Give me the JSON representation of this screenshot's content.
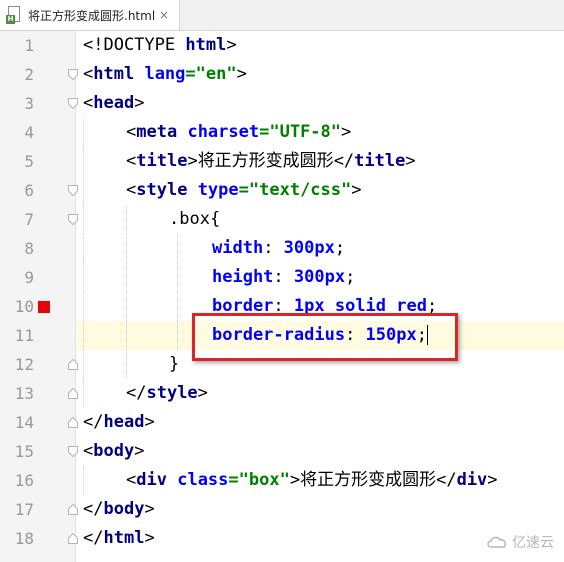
{
  "tab": {
    "title": "将正方形变成圆形.html",
    "icon": "html-file-icon",
    "close": "×"
  },
  "editor": {
    "current_line": 11,
    "breakpoint_line": 10,
    "colors": {
      "tag": "#000080",
      "attr": "#0000ff",
      "string": "#008000",
      "breakpoint": "#e8000b",
      "highlight_box": "#d62728",
      "current_line_bg": "#fffbe0"
    },
    "lines": [
      {
        "n": "1",
        "parts": [
          "<!DOCTYPE ",
          "html",
          ">"
        ]
      },
      {
        "n": "2",
        "parts": [
          "<",
          "html",
          " ",
          "lang",
          "=",
          "\"en\"",
          ">"
        ]
      },
      {
        "n": "3",
        "parts": [
          "<",
          "head",
          ">"
        ]
      },
      {
        "n": "4",
        "parts": [
          "<",
          "meta",
          " ",
          "charset",
          "=",
          "\"UTF-8\"",
          ">"
        ]
      },
      {
        "n": "5",
        "parts": [
          "<",
          "title",
          ">",
          "将正方形变成圆形",
          "</",
          "title",
          ">"
        ]
      },
      {
        "n": "6",
        "parts": [
          "<",
          "style",
          " ",
          "type",
          "=",
          "\"text/css\"",
          ">"
        ]
      },
      {
        "n": "7",
        "parts": [
          ".box{"
        ]
      },
      {
        "n": "8",
        "parts": [
          "width",
          ": ",
          "300px",
          ";"
        ]
      },
      {
        "n": "9",
        "parts": [
          "height",
          ": ",
          "300px",
          ";"
        ]
      },
      {
        "n": "10",
        "parts": [
          "border",
          ": ",
          "1px solid red",
          ";"
        ]
      },
      {
        "n": "11",
        "parts": [
          "border-radius",
          ": ",
          "150px",
          ";"
        ]
      },
      {
        "n": "12",
        "parts": [
          "}"
        ]
      },
      {
        "n": "13",
        "parts": [
          "</",
          "style",
          ">"
        ]
      },
      {
        "n": "14",
        "parts": [
          "</",
          "head",
          ">"
        ]
      },
      {
        "n": "15",
        "parts": [
          "<",
          "body",
          ">"
        ]
      },
      {
        "n": "16",
        "parts": [
          "<",
          "div",
          " ",
          "class",
          "=",
          "\"box\"",
          ">",
          "将正方形变成圆形",
          "</",
          "div",
          ">"
        ]
      },
      {
        "n": "17",
        "parts": [
          "</",
          "body",
          ">"
        ]
      },
      {
        "n": "18",
        "parts": [
          "</",
          "html",
          ">"
        ]
      }
    ]
  },
  "watermark": {
    "text": "亿速云",
    "icon": "cloud-logo-icon"
  }
}
